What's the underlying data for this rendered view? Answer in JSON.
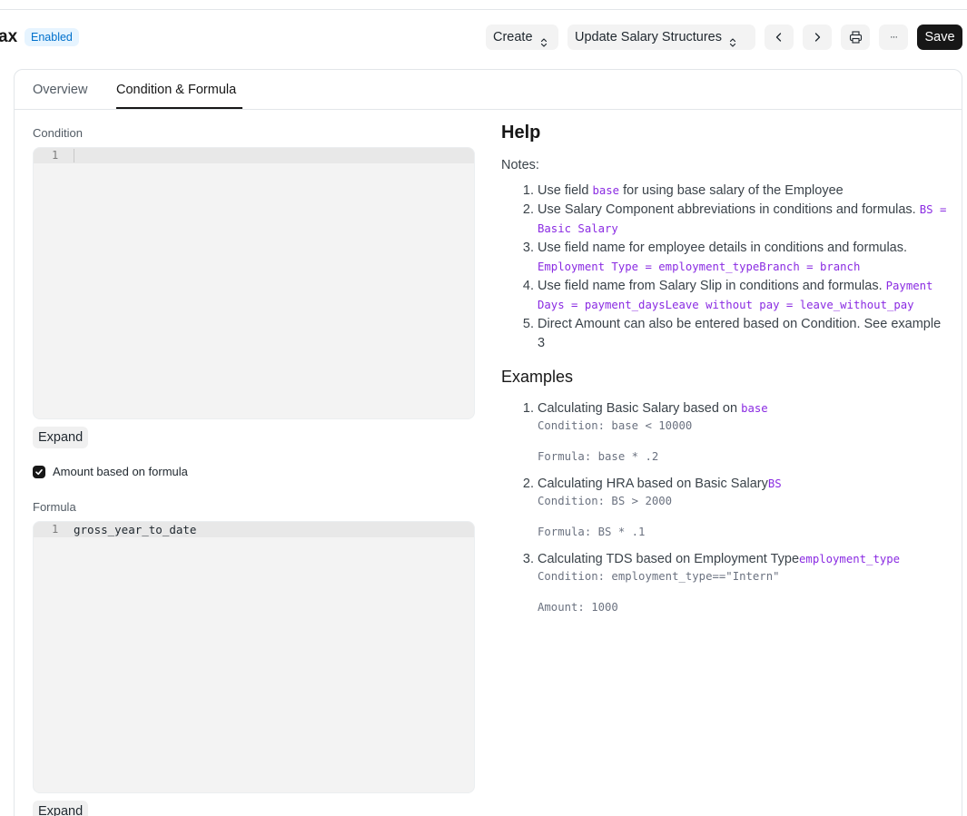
{
  "header": {
    "title": "ax",
    "status": "Enabled",
    "create_label": "Create",
    "update_label": "Update Salary Structures",
    "save_label": "Save",
    "more_label": "···"
  },
  "tabs": [
    {
      "label": "Overview"
    },
    {
      "label": "Condition & Formula"
    }
  ],
  "condition": {
    "label": "Condition",
    "line_number": "1",
    "value": "",
    "expand_label": "Expand"
  },
  "amount_based_on_formula": {
    "label": "Amount based on formula",
    "checked": true
  },
  "formula": {
    "label": "Formula",
    "line_number": "1",
    "value": "gross_year_to_date",
    "expand_label": "Expand"
  },
  "help": {
    "title": "Help",
    "notes_label": "Notes:",
    "notes": [
      {
        "num": "1.",
        "text": "Use field ",
        "code": "base",
        "after": " for using base salary of the Employee"
      },
      {
        "num": "2.",
        "text": "Use Salary Component abbreviations in conditions and formulas. ",
        "code": "BS = Basic Salary",
        "after": ""
      },
      {
        "num": "3.",
        "text": "Use field name for employee details in conditions and formulas. ",
        "code": "Employment Type = employment_typeBranch = branch",
        "after": ""
      },
      {
        "num": "4.",
        "text": "Use field name from Salary Slip in conditions and formulas. ",
        "code": "Payment Days = payment_daysLeave without pay = leave_without_pay",
        "after": ""
      },
      {
        "num": "5.",
        "text": "Direct Amount can also be entered based on Condition. See example 3",
        "code": "",
        "after": ""
      }
    ],
    "examples_title": "Examples",
    "examples": [
      {
        "text": "Calculating Basic Salary based on ",
        "code": "base",
        "line1": "Condition: base < 10000",
        "line2": "Formula: base * .2"
      },
      {
        "text": "Calculating HRA based on Basic Salary",
        "code": "BS",
        "line1": "Condition: BS > 2000",
        "line2": "Formula: BS * .1"
      },
      {
        "text": "Calculating TDS based on Employment Type",
        "code": "employment_type",
        "line1": "Condition: employment_type==\"Intern\"",
        "line2": "Amount: 1000"
      }
    ]
  },
  "colors": {
    "accent": "#171717",
    "badge_bg": "#e6f4ff",
    "badge_text": "#0070cc",
    "code": "#8a2be2"
  }
}
